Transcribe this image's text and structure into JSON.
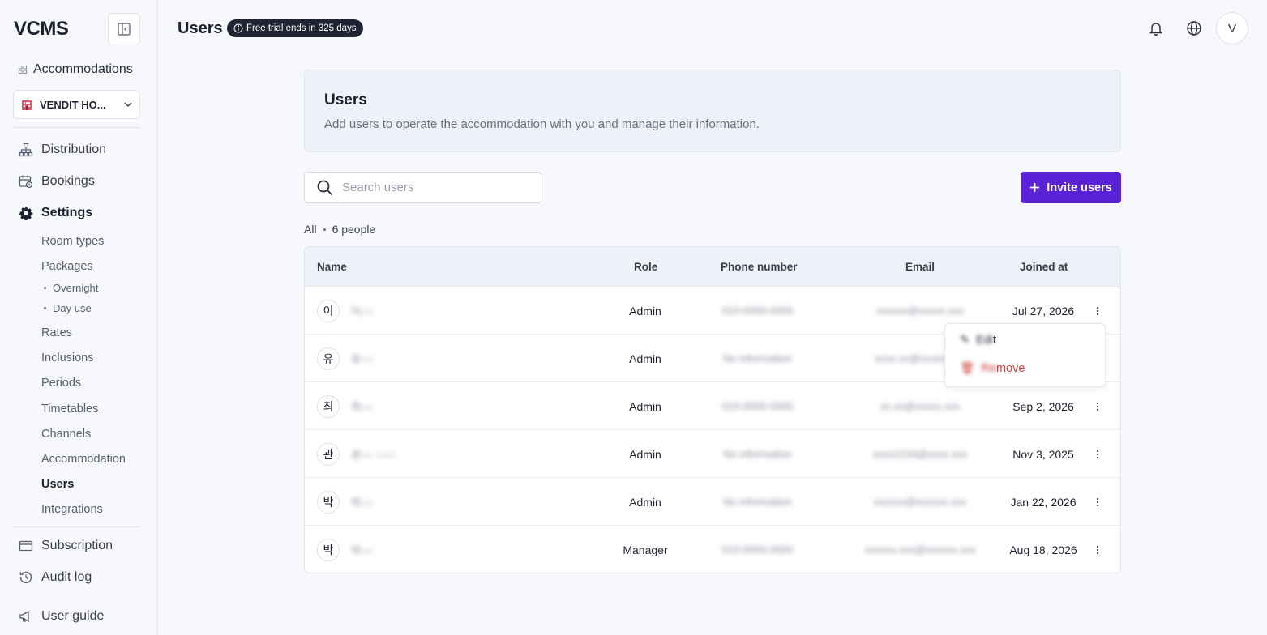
{
  "app": {
    "logo": "VCMS"
  },
  "sidebar": {
    "accommodations_label": "Accommodations",
    "selected_accommodation": "VENDIT HO...",
    "nav": {
      "distribution": "Distribution",
      "bookings": "Bookings",
      "settings": "Settings"
    },
    "settings_items": {
      "room_types": "Room types",
      "packages": "Packages",
      "overnight": "Overnight",
      "day_use": "Day use",
      "rates": "Rates",
      "inclusions": "Inclusions",
      "periods": "Periods",
      "timetables": "Timetables",
      "channels": "Channels",
      "accommodation": "Accommodation",
      "users": "Users",
      "integrations": "Integrations"
    },
    "bottom": {
      "subscription": "Subscription",
      "audit_log": "Audit log",
      "user_guide": "User guide"
    }
  },
  "header": {
    "title": "Users",
    "trial_badge": "Free trial ends in 325 days",
    "avatar_initial": "V"
  },
  "intro": {
    "title": "Users",
    "description": "Add users to operate the accommodation with you and manage their information."
  },
  "search": {
    "placeholder": "Search users"
  },
  "invite_button": "Invite users",
  "filter": {
    "label": "All",
    "count": "6 people"
  },
  "table": {
    "columns": {
      "name": "Name",
      "role": "Role",
      "phone": "Phone number",
      "email": "Email",
      "joined": "Joined at"
    },
    "rows": [
      {
        "initial": "이",
        "name": "이○○",
        "role": "Admin",
        "phone": "010-0000-0000",
        "email": "xxxxxx@xxxxx.xxx",
        "joined": "Jul 27, 2026"
      },
      {
        "initial": "유",
        "name": "유○○",
        "role": "Admin",
        "phone": "No information",
        "email": "xxxx.xx@xxxxx.xxx",
        "joined": ""
      },
      {
        "initial": "최",
        "name": "최○○",
        "role": "Admin",
        "phone": "010-0000-0000",
        "email": "xx.xx@xxxxx.xxx",
        "joined": "Sep 2, 2026"
      },
      {
        "initial": "관",
        "name": "관○○ ○○○",
        "role": "Admin",
        "phone": "No information",
        "email": "xxxx1234@xxxx.xxx",
        "joined": "Nov 3, 2025"
      },
      {
        "initial": "박",
        "name": "박○○",
        "role": "Admin",
        "phone": "No information",
        "email": "xxxxxx@xxxxxx.xxx",
        "joined": "Jan 22, 2026"
      },
      {
        "initial": "박",
        "name": "박○○",
        "role": "Manager",
        "phone": "010-0000-0000",
        "email": "xxxxxx.xxx@xxxxxx.xxx",
        "joined": "Aug 18, 2026"
      }
    ]
  },
  "row_menu": {
    "edit_hidden": "Edi",
    "edit_visible": "t",
    "remove_hidden": "Re",
    "remove_visible": "move"
  },
  "colors": {
    "accent": "#5b21d6",
    "danger": "#d23b3b",
    "trial_badge_bg": "#1f2433"
  }
}
